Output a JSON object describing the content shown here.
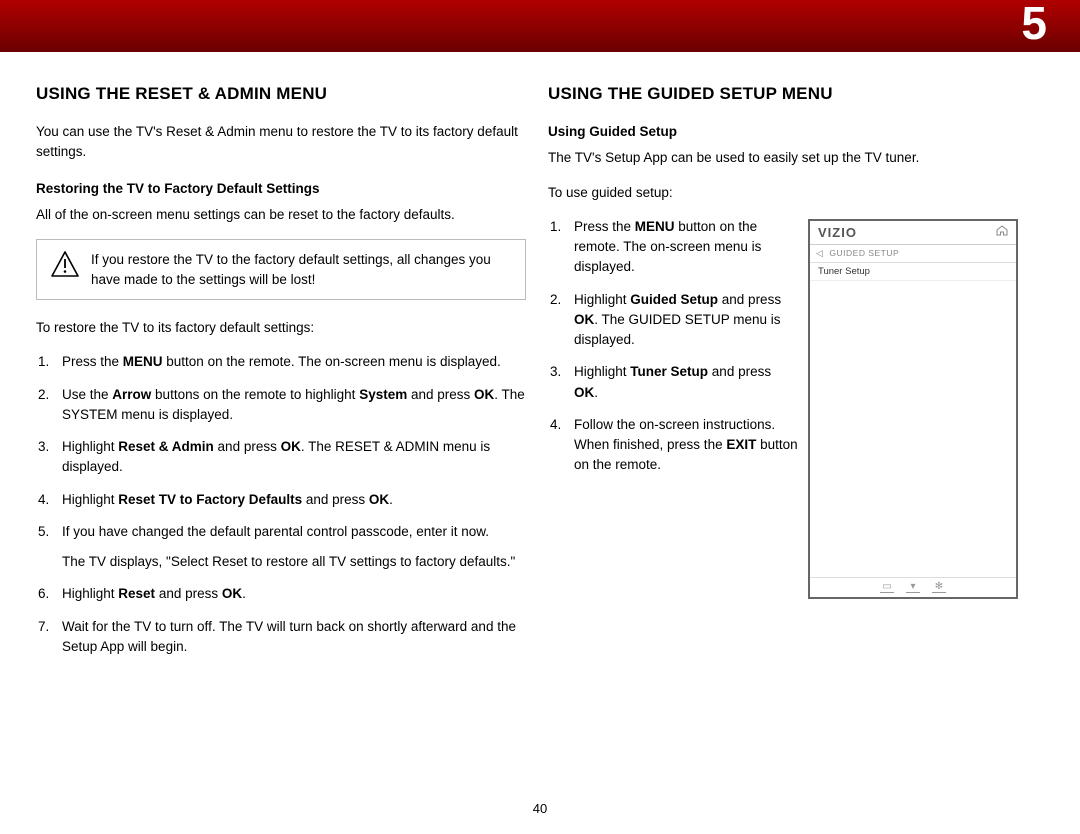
{
  "chapter_number": "5",
  "page_number": "40",
  "left": {
    "heading": "USING THE RESET & ADMIN MENU",
    "intro": "You can use the TV's Reset & Admin menu to restore the TV to its factory default settings.",
    "sub1": "Restoring the TV to Factory Default Settings",
    "sub1_p": "All of the on-screen menu settings can be reset to the factory defaults.",
    "warning": "If you restore the TV to the factory default settings, all changes you have made to the settings will be lost!",
    "restore_lead": "To restore the TV to its factory default settings:",
    "step1_a": "Press the ",
    "step1_b": "MENU",
    "step1_c": " button on the remote. The on-screen menu is displayed.",
    "step2_a": "Use the ",
    "step2_b": "Arrow",
    "step2_c": " buttons on the remote to highlight ",
    "step2_d": "System",
    "step2_e": " and press ",
    "step2_f": "OK",
    "step2_g": ". The SYSTEM menu is displayed.",
    "step3_a": "Highlight ",
    "step3_b": "Reset & Admin",
    "step3_c": " and press ",
    "step3_d": "OK",
    "step3_e": ". The RESET & ADMIN menu is displayed.",
    "step4_a": "Highlight ",
    "step4_b": "Reset TV to Factory Defaults",
    "step4_c": " and press ",
    "step4_d": "OK",
    "step4_e": ".",
    "step5_a": "If you have changed the default parental control passcode, enter it now.",
    "step5_sub": "The TV displays, \"Select Reset to restore all TV settings to factory defaults.\"",
    "step6_a": "Highlight ",
    "step6_b": "Reset",
    "step6_c": " and press ",
    "step6_d": "OK",
    "step6_e": ".",
    "step7": "Wait for the TV to turn off. The TV will turn back on shortly afterward and the Setup App will begin."
  },
  "right": {
    "heading": "USING THE GUIDED SETUP MENU",
    "sub1": "Using Guided Setup",
    "sub1_p": "The TV's Setup App can be used to easily set up the TV tuner.",
    "lead": "To use guided setup:",
    "step1_a": "Press the ",
    "step1_b": "MENU",
    "step1_c": " button on the remote. The on-screen menu is displayed.",
    "step2_a": "Highlight ",
    "step2_b": "Guided Setup",
    "step2_c": " and press ",
    "step2_d": "OK",
    "step2_e": ". The GUIDED SETUP menu is displayed.",
    "step3_a": "Highlight ",
    "step3_b": "Tuner Setup",
    "step3_c": " and press ",
    "step3_d": "OK",
    "step3_e": ".",
    "step4_a": "Follow the on-screen instructions. When finished, press the ",
    "step4_b": "EXIT",
    "step4_c": " button on the remote."
  },
  "tv": {
    "logo": "VIZIO",
    "crumb": "GUIDED SETUP",
    "item1": "Tuner Setup"
  }
}
